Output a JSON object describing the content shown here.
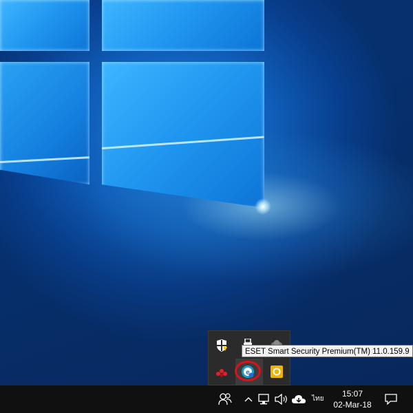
{
  "desktop": {
    "wallpaper": "windows-10-hero",
    "accent": "#1f95ef"
  },
  "tray_popup": {
    "icons": [
      {
        "name": "windows-defender-warning-icon",
        "color": "#ffcc00"
      },
      {
        "name": "usb-eject-icon",
        "color": "#ffffff"
      },
      {
        "name": "cloud-sync-icon",
        "color": "#888888"
      },
      {
        "name": "red-app-icon",
        "color": "#e0202a"
      },
      {
        "name": "eset-icon",
        "color": "#1b9fc9"
      },
      {
        "name": "outlook-icon",
        "color": "#f0b400"
      }
    ],
    "highlight_color": "#e0101a"
  },
  "tooltip": {
    "text": "ESET Smart Security Premium(TM) 11.0.159.9"
  },
  "taskbar": {
    "language": "ไทย",
    "time": "15:07",
    "date": "02-Mar-18",
    "icons": [
      "people-icon",
      "chevron-up-icon",
      "network-icon",
      "volume-icon",
      "onedrive-icon",
      "action-center-icon"
    ]
  }
}
